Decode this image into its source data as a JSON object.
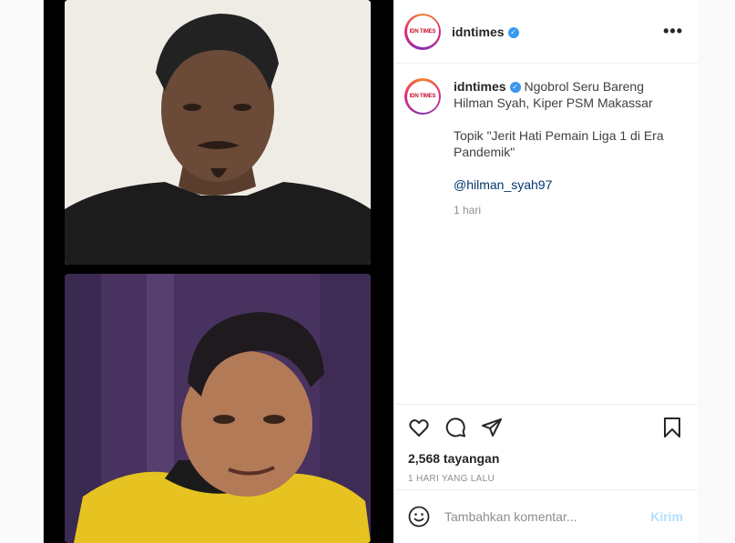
{
  "account": {
    "username": "idntimes",
    "avatar_text": "IDN TIMES"
  },
  "header": {
    "more_label": "•••"
  },
  "caption": {
    "username": "idntimes",
    "line1": "Ngobrol Seru Bareng Hilman Syah, Kiper PSM Makassar",
    "line2": "Topik \"Jerit Hati Pemain Liga 1 di Era Pandemik\"",
    "mention": "@hilman_syah97",
    "time": "1 hari"
  },
  "stats": {
    "views": "2,568 tayangan",
    "ago": "1 HARI YANG LALU"
  },
  "comment": {
    "placeholder": "Tambahkan komentar...",
    "send_label": "Kirim"
  },
  "icons": {
    "like": "heart-icon",
    "comment": "comment-icon",
    "share": "share-icon",
    "save": "bookmark-icon",
    "emoji": "emoji-icon",
    "verified": "verified-icon"
  },
  "colors": {
    "verified": "#3897f0",
    "link": "#00376b",
    "send": "#b2dffc"
  }
}
